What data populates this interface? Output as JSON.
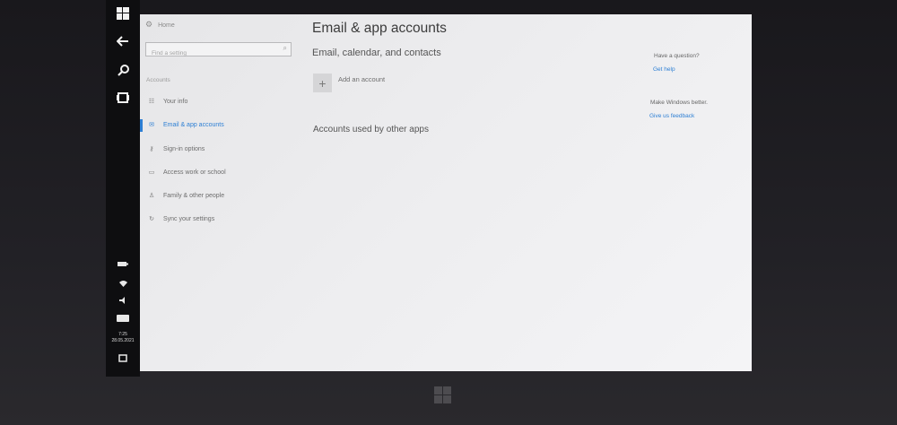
{
  "taskbar": {
    "icons": [
      "windows-logo-icon",
      "back-arrow-icon",
      "search-icon",
      "task-view-icon"
    ],
    "tray": [
      "battery-icon",
      "network-icon",
      "volume-icon",
      "keyboard-icon",
      "notifications-icon"
    ],
    "clock": {
      "time": "7:25",
      "date": "28.05.2021"
    }
  },
  "nav": {
    "home_label": "Home",
    "search_placeholder": "Find a setting",
    "section_label": "Accounts",
    "items": [
      {
        "label": "Your info",
        "icon": "contact-card-icon",
        "active": false
      },
      {
        "label": "Email & app accounts",
        "icon": "mail-icon",
        "active": true
      },
      {
        "label": "Sign-in options",
        "icon": "key-icon",
        "active": false
      },
      {
        "label": "Access work or school",
        "icon": "briefcase-icon",
        "active": false
      },
      {
        "label": "Family & other people",
        "icon": "people-icon",
        "active": false
      },
      {
        "label": "Sync your settings",
        "icon": "sync-icon",
        "active": false
      }
    ]
  },
  "main": {
    "title": "Email & app accounts",
    "subheading": "Email, calendar, and contacts",
    "add_account_label": "Add an account",
    "other_apps_heading": "Accounts used by other apps"
  },
  "side": {
    "question": "Have a question?",
    "help_link": "Get help",
    "better": "Make Windows better.",
    "feedback_link": "Give us feedback"
  },
  "colors": {
    "accent": "#2d7fd4",
    "taskbar": "#0e0e10",
    "background": "#ececee"
  }
}
